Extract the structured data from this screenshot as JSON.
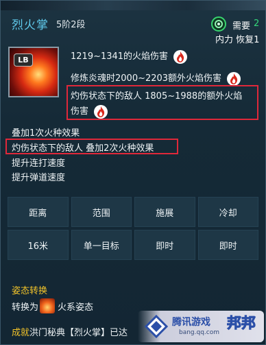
{
  "header": {
    "title": "烈火掌",
    "rank": "5阶2段",
    "need_label": "需要",
    "need_value": "2",
    "cost_label": "内力 恢复1",
    "need_icon": "green-swirl-icon"
  },
  "skill": {
    "icon": "fire-palm-skill-icon",
    "keybind": "LB"
  },
  "effects": {
    "line1": "1219~1341的火焰伤害",
    "line2": "修炼炎魂时2000~2203额外火焰伤害",
    "line3a": "灼伤状态下的敌人 1805~1988的额外火焰",
    "line3b": "伤害",
    "line4": "叠加1次火种效果",
    "line5": "灼伤状态下的敌人 叠加2次火种效果",
    "line6": "提升连打速度",
    "line7": "提升弹道速度"
  },
  "stats": {
    "headers": [
      "距离",
      "范围",
      "施展",
      "冷却"
    ],
    "values": [
      "16米",
      "单一目标",
      "即时",
      "即时"
    ]
  },
  "stance": {
    "title": "姿态转换",
    "prefix": "转换为",
    "target": "火系姿态",
    "icon": "fire-stance-icon"
  },
  "footer": {
    "prefix": "成就",
    "text": "洪门秘典【烈火掌】已达"
  },
  "watermark": {
    "brand": "腾讯游戏",
    "brand2": "邦邦",
    "url": "bang.qq.com"
  },
  "colors": {
    "title": "#5fc8ea",
    "highlight_box": "#e0283a",
    "gold": "#f2c32a",
    "need_value": "#34d77a"
  }
}
